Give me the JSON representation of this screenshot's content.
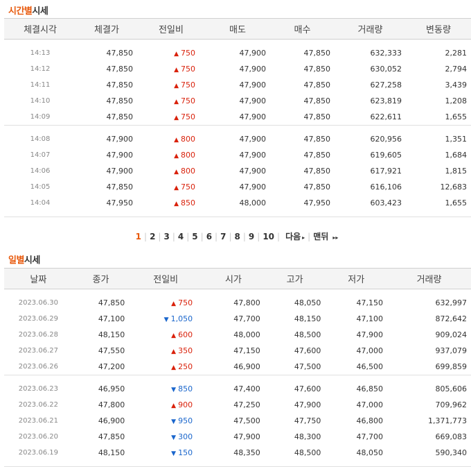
{
  "sections": {
    "time": {
      "title_hl": "시간별",
      "title_rest": "시세"
    },
    "daily": {
      "title_hl": "일별",
      "title_rest": "시세"
    }
  },
  "time_table": {
    "headers": [
      "체결시각",
      "체결가",
      "전일비",
      "매도",
      "매수",
      "거래량",
      "변동량"
    ],
    "groups": [
      [
        [
          "14:13",
          "47,850",
          "up",
          "750",
          "47,900",
          "47,850",
          "632,333",
          "2,281"
        ],
        [
          "14:12",
          "47,850",
          "up",
          "750",
          "47,900",
          "47,850",
          "630,052",
          "2,794"
        ],
        [
          "14:11",
          "47,850",
          "up",
          "750",
          "47,900",
          "47,850",
          "627,258",
          "3,439"
        ],
        [
          "14:10",
          "47,850",
          "up",
          "750",
          "47,900",
          "47,850",
          "623,819",
          "1,208"
        ],
        [
          "14:09",
          "47,850",
          "up",
          "750",
          "47,900",
          "47,850",
          "622,611",
          "1,655"
        ]
      ],
      [
        [
          "14:08",
          "47,900",
          "up",
          "800",
          "47,900",
          "47,850",
          "620,956",
          "1,351"
        ],
        [
          "14:07",
          "47,900",
          "up",
          "800",
          "47,900",
          "47,850",
          "619,605",
          "1,684"
        ],
        [
          "14:06",
          "47,900",
          "up",
          "800",
          "47,900",
          "47,850",
          "617,921",
          "1,815"
        ],
        [
          "14:05",
          "47,850",
          "up",
          "750",
          "47,900",
          "47,850",
          "616,106",
          "12,683"
        ],
        [
          "14:04",
          "47,950",
          "up",
          "850",
          "48,000",
          "47,950",
          "603,423",
          "1,655"
        ]
      ]
    ]
  },
  "pagination": {
    "pages": [
      "1",
      "2",
      "3",
      "4",
      "5",
      "6",
      "7",
      "8",
      "9",
      "10"
    ],
    "current": "1",
    "next_label": "다음",
    "last_label": "맨뒤"
  },
  "daily_table": {
    "headers": [
      "날짜",
      "종가",
      "전일비",
      "시가",
      "고가",
      "저가",
      "거래량"
    ],
    "groups": [
      [
        [
          "2023.06.30",
          "47,850",
          "up",
          "750",
          "47,800",
          "48,050",
          "47,150",
          "632,997"
        ],
        [
          "2023.06.29",
          "47,100",
          "down",
          "1,050",
          "47,700",
          "48,150",
          "47,100",
          "872,642"
        ],
        [
          "2023.06.28",
          "48,150",
          "up",
          "600",
          "48,000",
          "48,500",
          "47,900",
          "909,024"
        ],
        [
          "2023.06.27",
          "47,550",
          "up",
          "350",
          "47,150",
          "47,600",
          "47,000",
          "937,079"
        ],
        [
          "2023.06.26",
          "47,200",
          "up",
          "250",
          "46,900",
          "47,500",
          "46,500",
          "699,859"
        ]
      ],
      [
        [
          "2023.06.23",
          "46,950",
          "down",
          "850",
          "47,400",
          "47,600",
          "46,850",
          "805,606"
        ],
        [
          "2023.06.22",
          "47,800",
          "up",
          "900",
          "47,250",
          "47,900",
          "47,000",
          "709,962"
        ],
        [
          "2023.06.21",
          "46,900",
          "down",
          "950",
          "47,500",
          "47,750",
          "46,800",
          "1,371,773"
        ],
        [
          "2023.06.20",
          "47,850",
          "down",
          "300",
          "47,900",
          "48,300",
          "47,700",
          "669,083"
        ],
        [
          "2023.06.19",
          "48,150",
          "down",
          "150",
          "48,350",
          "48,500",
          "48,050",
          "590,340"
        ]
      ]
    ]
  },
  "colors": {
    "up": "#d9210b",
    "down": "#1a66cc",
    "accent": "#e8590c"
  },
  "icons": {
    "up": "triangle-up-icon",
    "down": "triangle-down-icon",
    "next": "caret-right-icon",
    "last": "double-caret-right-icon"
  }
}
